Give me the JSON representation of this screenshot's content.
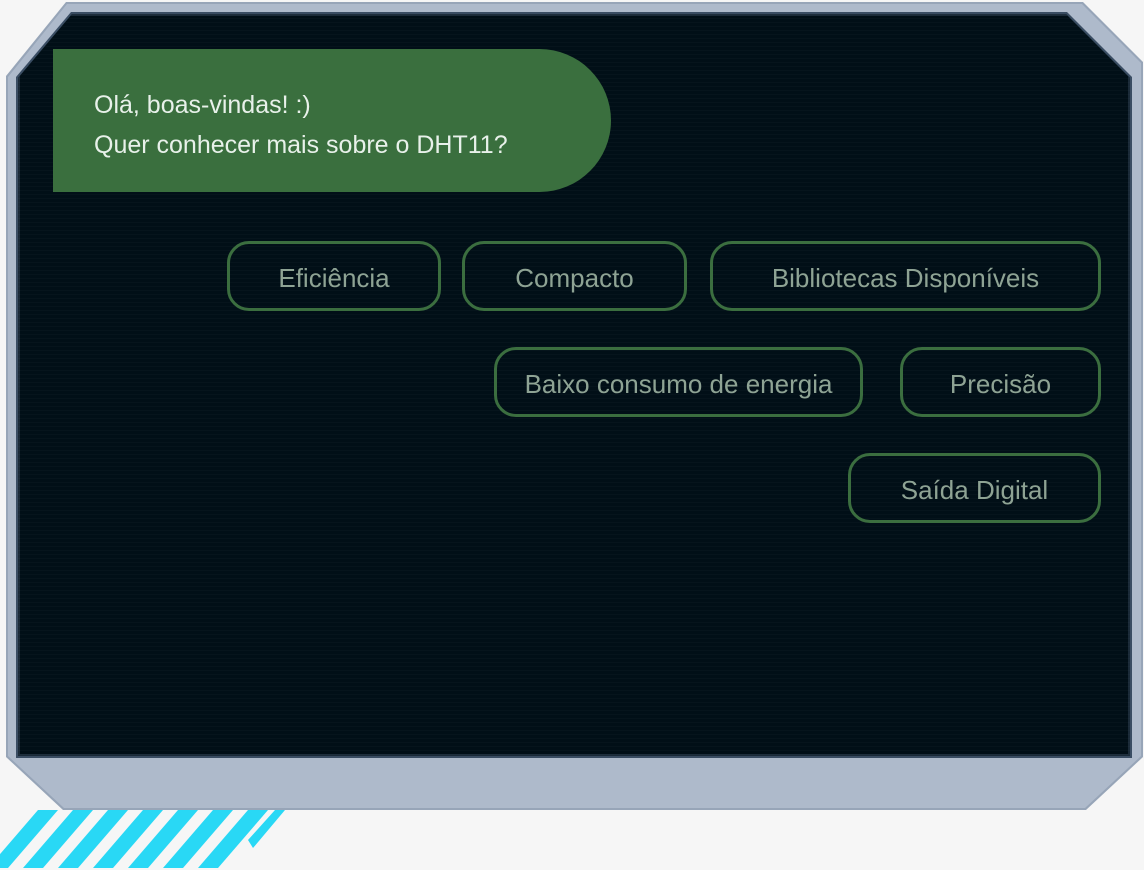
{
  "welcome": {
    "line1": "Olá, boas-vindas! :)",
    "line2": "Quer conhecer mais sobre o DHT11?"
  },
  "options": {
    "eficiencia": "Eficiência",
    "compacto": "Compacto",
    "bibliotecas": "Bibliotecas Disponíveis",
    "baixo_consumo": "Baixo consumo de energia",
    "precisao": "Precisão",
    "saida_digital": "Saída Digital"
  },
  "colors": {
    "screen": "#010f17",
    "frame": "#aebacb",
    "bubble": "#3a6f3e",
    "chip_border": "#3b6e3f",
    "chip_text": "#8ea394",
    "stripe": "#29d8f5"
  }
}
